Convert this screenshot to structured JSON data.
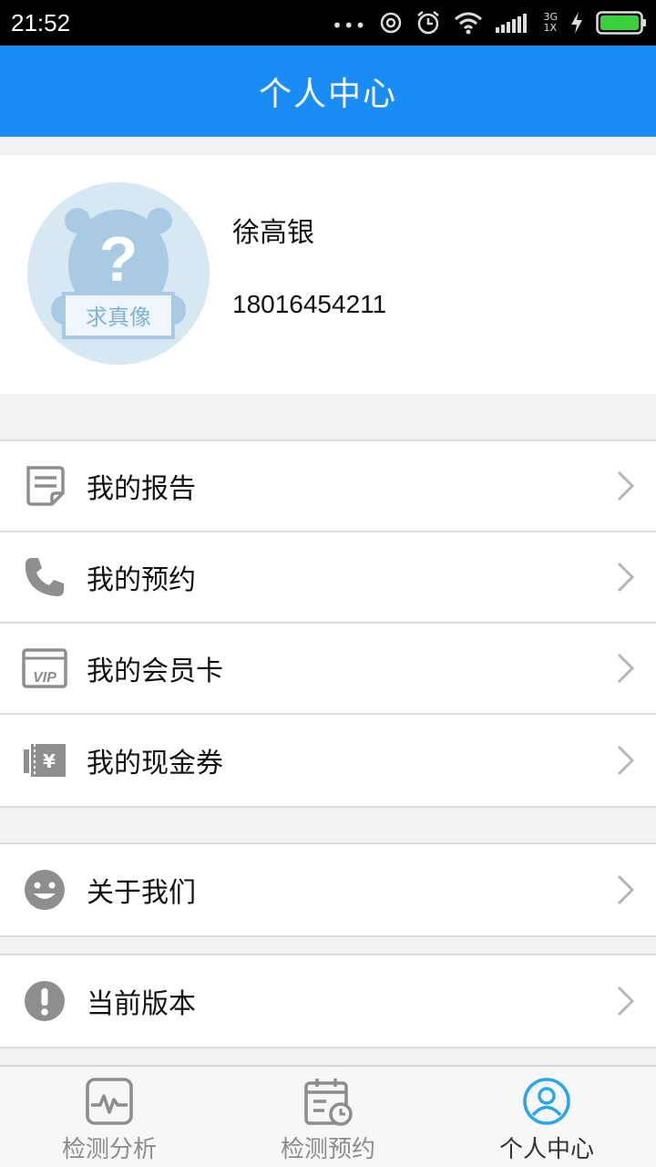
{
  "status_bar": {
    "time": "21:52",
    "network_top": "3G",
    "network_bottom": "1X",
    "icons": [
      "more-dots-icon",
      "hotspot-icon",
      "alarm-icon",
      "wifi-icon",
      "signal-icon",
      "charging-icon",
      "battery-icon"
    ]
  },
  "header": {
    "title": "个人中心"
  },
  "profile": {
    "name": "徐高银",
    "phone": "18016454211",
    "avatar_text": "求真像"
  },
  "menu": {
    "group1": [
      {
        "label": "我的报告",
        "icon": "report-icon"
      },
      {
        "label": "我的预约",
        "icon": "phone-icon"
      },
      {
        "label": "我的会员卡",
        "icon": "vip-card-icon"
      },
      {
        "label": "我的现金券",
        "icon": "cash-coupon-icon"
      }
    ],
    "group2": [
      {
        "label": "关于我们",
        "icon": "smiley-icon"
      }
    ],
    "group3": [
      {
        "label": "当前版本",
        "icon": "exclamation-icon"
      }
    ]
  },
  "tabs": [
    {
      "label": "检测分析",
      "icon": "pulse-icon",
      "active": false
    },
    {
      "label": "检测预约",
      "icon": "calendar-icon",
      "active": false
    },
    {
      "label": "个人中心",
      "icon": "person-icon",
      "active": true
    }
  ],
  "colors": {
    "accent": "#1a8cf5",
    "active_tab_icon": "#2aa6ea",
    "icon_gray": "#8e8e8e",
    "background": "#f2f2f2"
  }
}
